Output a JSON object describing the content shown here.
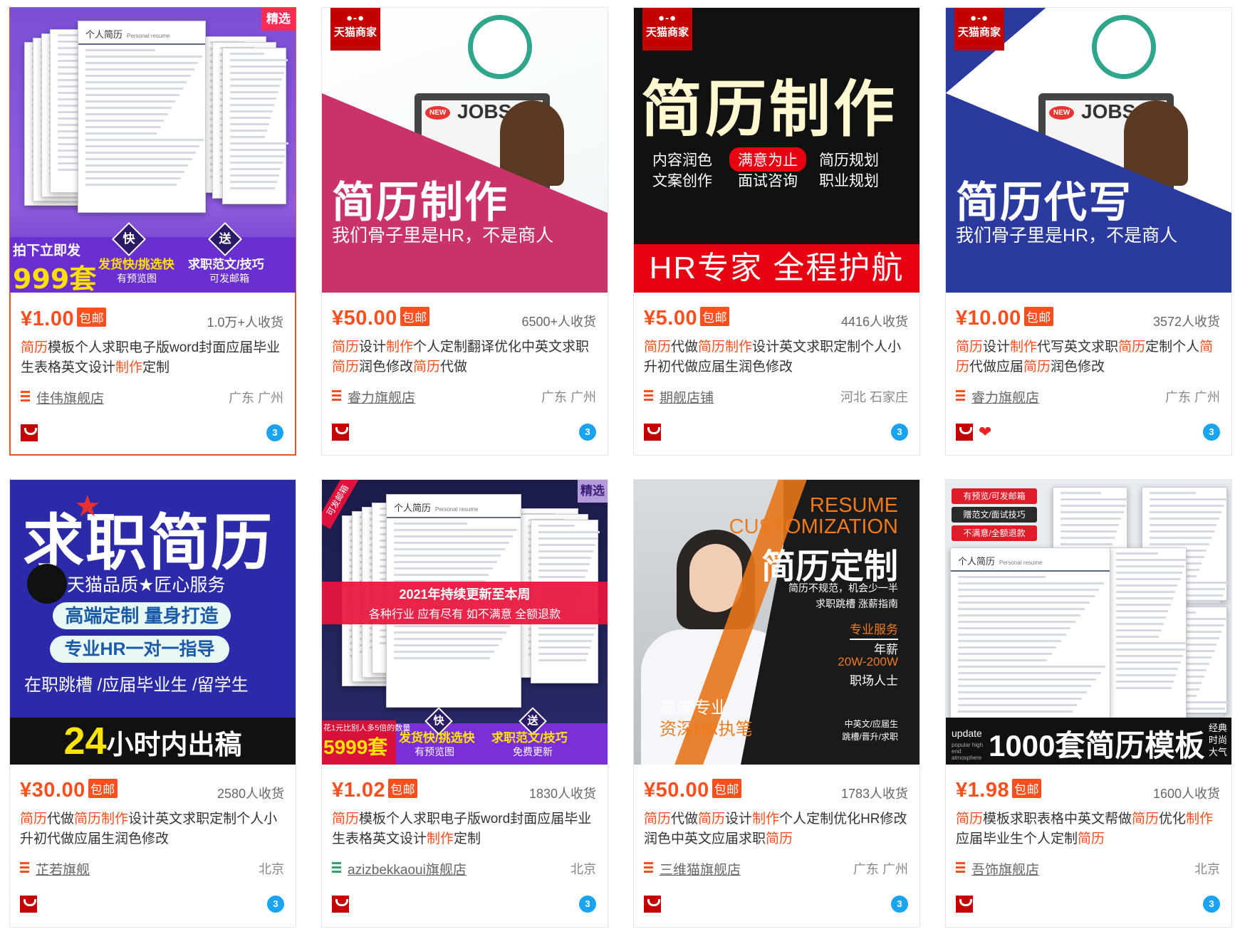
{
  "products": [
    {
      "price": "¥1.00",
      "free_ship": "包邮",
      "sold": "1.0万+人收货",
      "title_parts": [
        {
          "t": "简历",
          "hl": true
        },
        {
          "t": "模板个人求职电子版word封面应届毕业生表格英文设计",
          "hl": false
        },
        {
          "t": "制作",
          "hl": true
        },
        {
          "t": "定制",
          "hl": false
        }
      ],
      "shop": "佳伟旗舰店",
      "location": "广东 广州",
      "thumb": {
        "tag": "精选",
        "doc_title": "个人简历",
        "doc_sub": "Personal resume",
        "promo_a": "拍下立即发",
        "promo_b": "999套",
        "badge_a": "快",
        "badge_b": "送",
        "feat_a": "发货快/挑选快",
        "feat_a_sub": "有预览图",
        "feat_b": "求职范文/技巧",
        "feat_b_sub": "可发邮箱"
      }
    },
    {
      "price": "¥50.00",
      "free_ship": "包邮",
      "sold": "6500+人收货",
      "title_parts": [
        {
          "t": "简历",
          "hl": true
        },
        {
          "t": "设计",
          "hl": false
        },
        {
          "t": "制作",
          "hl": true
        },
        {
          "t": "个人定制翻译优化中英文求职",
          "hl": false
        },
        {
          "t": "简历",
          "hl": true
        },
        {
          "t": "润色修改",
          "hl": false
        },
        {
          "t": "简历",
          "hl": true
        },
        {
          "t": "代做",
          "hl": false
        }
      ],
      "shop": "睿力旗舰店",
      "location": "广东 广州",
      "thumb": {
        "corner": "天猫商家",
        "newtag": "NEW",
        "jobs": "JOBS",
        "headline": "简历制作",
        "sub": "我们骨子里是HR，不是商人"
      }
    },
    {
      "price": "¥5.00",
      "free_ship": "包邮",
      "sold": "4416人收货",
      "title_parts": [
        {
          "t": "简历",
          "hl": true
        },
        {
          "t": "代做",
          "hl": false
        },
        {
          "t": "简历",
          "hl": true
        },
        {
          "t": "制作",
          "hl": true
        },
        {
          "t": "设计英文求职定制个人小升初代做应届生润色修改",
          "hl": false
        }
      ],
      "shop": "期舰店铺",
      "location": "河北 石家庄",
      "thumb": {
        "corner": "天猫商家",
        "headline": "简历制作",
        "c1a": "内容润色",
        "c1b": "文案创作",
        "c2a": "满意为止",
        "c2b": "面试咨询",
        "c3a": "简历规划",
        "c3b": "职业规划",
        "banner": "HR专家 全程护航"
      }
    },
    {
      "price": "¥10.00",
      "free_ship": "包邮",
      "sold": "3572人收货",
      "title_parts": [
        {
          "t": "简历",
          "hl": true
        },
        {
          "t": "设计",
          "hl": false
        },
        {
          "t": "制作",
          "hl": true
        },
        {
          "t": "代写英文求职",
          "hl": false
        },
        {
          "t": "简历",
          "hl": true
        },
        {
          "t": "定制个人",
          "hl": false
        },
        {
          "t": "简历",
          "hl": true
        },
        {
          "t": "代做应届",
          "hl": false
        },
        {
          "t": "简历",
          "hl": true
        },
        {
          "t": "润色修改",
          "hl": false
        }
      ],
      "shop": "睿力旗舰店",
      "location": "广东 广州",
      "thumb": {
        "corner": "天猫商家",
        "newtag": "NEW",
        "jobs": "JOBS",
        "headline": "简历代写",
        "sub": "我们骨子里是HR，不是商人"
      }
    },
    {
      "price": "¥30.00",
      "free_ship": "包邮",
      "sold": "2580人收货",
      "title_parts": [
        {
          "t": "简历",
          "hl": true
        },
        {
          "t": "代做",
          "hl": false
        },
        {
          "t": "简历",
          "hl": true
        },
        {
          "t": "制作",
          "hl": true
        },
        {
          "t": "设计英文求职定制个人小升初代做应届生润色修改",
          "hl": false
        }
      ],
      "shop": "芷若旗舰",
      "location": "北京",
      "thumb": {
        "headline": "求职简历",
        "quality": "天猫品质★匠心服务",
        "pill_a": "高端定制  量身打造",
        "pill_b": "专业HR一对一指导",
        "line": "在职跳槽 /应届毕业生 /留学生",
        "banner_num": "24",
        "banner_txt": "小时内出稿"
      }
    },
    {
      "price": "¥1.02",
      "free_ship": "包邮",
      "sold": "1830人收货",
      "title_parts": [
        {
          "t": "简历",
          "hl": true
        },
        {
          "t": "模板个人求职电子版word封面应届毕业生表格英文设计",
          "hl": false
        },
        {
          "t": "制作",
          "hl": true
        },
        {
          "t": "定制",
          "hl": false
        }
      ],
      "shop": "azizbekkaoui旗舰店",
      "location": "北京",
      "thumb": {
        "tag": "精选",
        "ribbon": "可发邮箱",
        "doc_title": "个人简历",
        "doc_sub": "Personal resume",
        "banner_a": "2021年持续更新至本周",
        "banner_b": "各种行业 应有尽有 如不满意 全额退款",
        "promo_a": "花1元比别人多5倍的数量",
        "promo_b": "5999套",
        "badge_a": "快",
        "badge_b": "送",
        "feat_a": "发货快/挑选快",
        "feat_a_sub": "有预览图",
        "feat_b": "求职范文/技巧",
        "feat_b_sub": "免费更新"
      }
    },
    {
      "price": "¥50.00",
      "free_ship": "包邮",
      "sold": "1783人收货",
      "title_parts": [
        {
          "t": "简历",
          "hl": true
        },
        {
          "t": "代做",
          "hl": false
        },
        {
          "t": "简历",
          "hl": true
        },
        {
          "t": "设计",
          "hl": false
        },
        {
          "t": "制作",
          "hl": true
        },
        {
          "t": "个人定制优化HR修改润色中英文应届求职",
          "hl": false
        },
        {
          "t": "简历",
          "hl": true
        }
      ],
      "shop": "三维猫旗舰店",
      "location": "广东 广州",
      "thumb": {
        "en1": "RESUME",
        "en2": "CUSTOMIZATION",
        "headline": "简历定制",
        "s1": "简历不规范，机会少一半",
        "s2": "求职跳槽 涨薪指南",
        "s3": "专业服务",
        "s4": "年薪",
        "s5": "20W-200W",
        "s6": "职场人士",
        "bl1": "高端专业",
        "bl2": "资深HR执笔",
        "br1": "中英文/应届生",
        "br2": "跳槽/晋升/求职"
      }
    },
    {
      "price": "¥1.98",
      "free_ship": "包邮",
      "sold": "1600人收货",
      "title_parts": [
        {
          "t": "简历",
          "hl": true
        },
        {
          "t": "模板求职表格中英文帮做",
          "hl": false
        },
        {
          "t": "简历",
          "hl": true
        },
        {
          "t": "优化",
          "hl": false
        },
        {
          "t": "制作",
          "hl": true
        },
        {
          "t": "应届毕业生个人定制",
          "hl": false
        },
        {
          "t": "简历",
          "hl": true
        }
      ],
      "shop": "吾饰旗舰店",
      "location": "北京",
      "thumb": {
        "tag1": "有预览/可发邮箱",
        "tag2": "赠范文/面试技巧",
        "tag3": "不满意/全额退款",
        "doc_title": "个人简历",
        "doc_sub": "Personal resume",
        "upd": "update",
        "upd_sub": "popular high end atmosphere",
        "banner": "1000套简历模板",
        "side": "经典 时尚 大气"
      }
    }
  ],
  "colors": {
    "accent": "#ff4f1f",
    "tmall_red": "#c40000",
    "wangwang_blue": "#1aa4f0"
  },
  "icons": {
    "shop": "shop-list-icon",
    "tmall": "tmall-icon",
    "wangwang": "wangwang-chat-icon"
  }
}
